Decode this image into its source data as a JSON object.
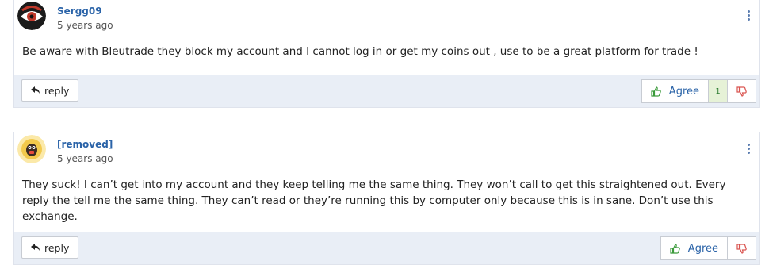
{
  "comments": [
    {
      "user": "Sergg09",
      "time": "5 years ago",
      "text": "Be aware with Bleutrade they block my account and I cannot log in or get my coins out , use to be a great platform for trade !",
      "reply_label": "reply",
      "agree_label": "Agree",
      "agree_count": "1",
      "avatar_icon": "eye-avatar-icon"
    },
    {
      "user": "[removed]",
      "time": "5 years ago",
      "text": "They suck! I can’t get into my account and they keep telling me the same thing. They won’t call to get this straightened out. Every reply the tell me the same thing. They can’t read or they’re running this by computer only because this is in sane. Don’t use this exchange.",
      "reply_label": "reply",
      "agree_label": "Agree",
      "avatar_icon": "mascot-avatar-icon"
    }
  ],
  "colors": {
    "username": "#2a63a8",
    "agree_icon": "#3a9a3a",
    "disagree_icon": "#d9534f",
    "footer_bg": "#e9eef6"
  }
}
